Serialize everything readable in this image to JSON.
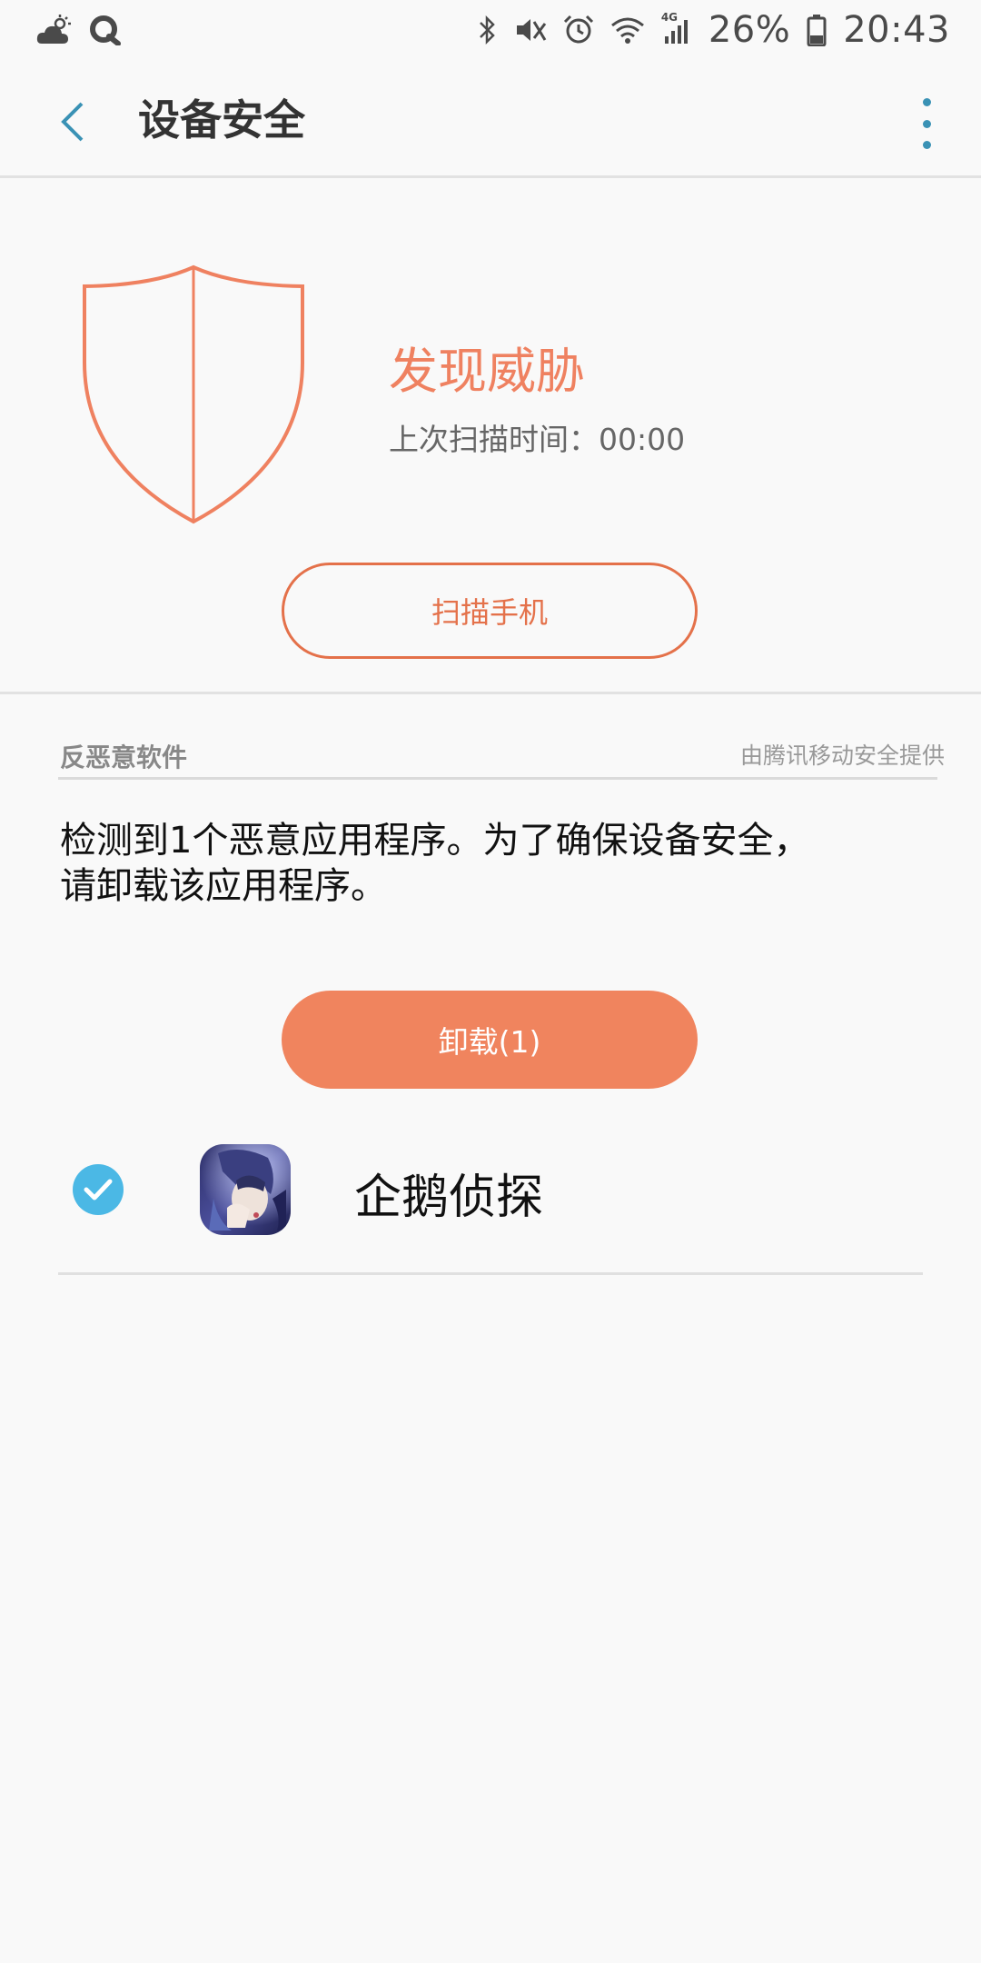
{
  "status_bar": {
    "battery": "26%",
    "time": "20:43",
    "network": "4G",
    "left_icons": [
      "weather-cloud-icon",
      "qq-icon"
    ],
    "right_icons": [
      "bluetooth-icon",
      "mute-icon",
      "alarm-icon",
      "wifi-icon",
      "signal-icon",
      "battery-icon"
    ]
  },
  "app_bar": {
    "title": "设备安全",
    "back_icon": "chevron-left-icon",
    "more_icon": "more-vertical-icon"
  },
  "hero": {
    "status_title": "发现威胁",
    "scan_time": "上次扫描时间：00:00",
    "scan_button": "扫描手机",
    "shield_icon": "shield-icon"
  },
  "section": {
    "title": "反恶意软件",
    "provider": "由腾讯移动安全提供"
  },
  "message": {
    "line1": "检测到1个恶意应用程序。为了确保设备安全，",
    "line2": "请卸载该应用程序。"
  },
  "uninstall_button": "卸载(1)",
  "apps": [
    {
      "name": "企鹅侦探",
      "checked": true
    }
  ],
  "colors": {
    "accent_orange": "#ef8160",
    "button_fill": "#f0845e",
    "check_blue": "#4bb8e5",
    "icon_blue": "#3a92b5"
  }
}
